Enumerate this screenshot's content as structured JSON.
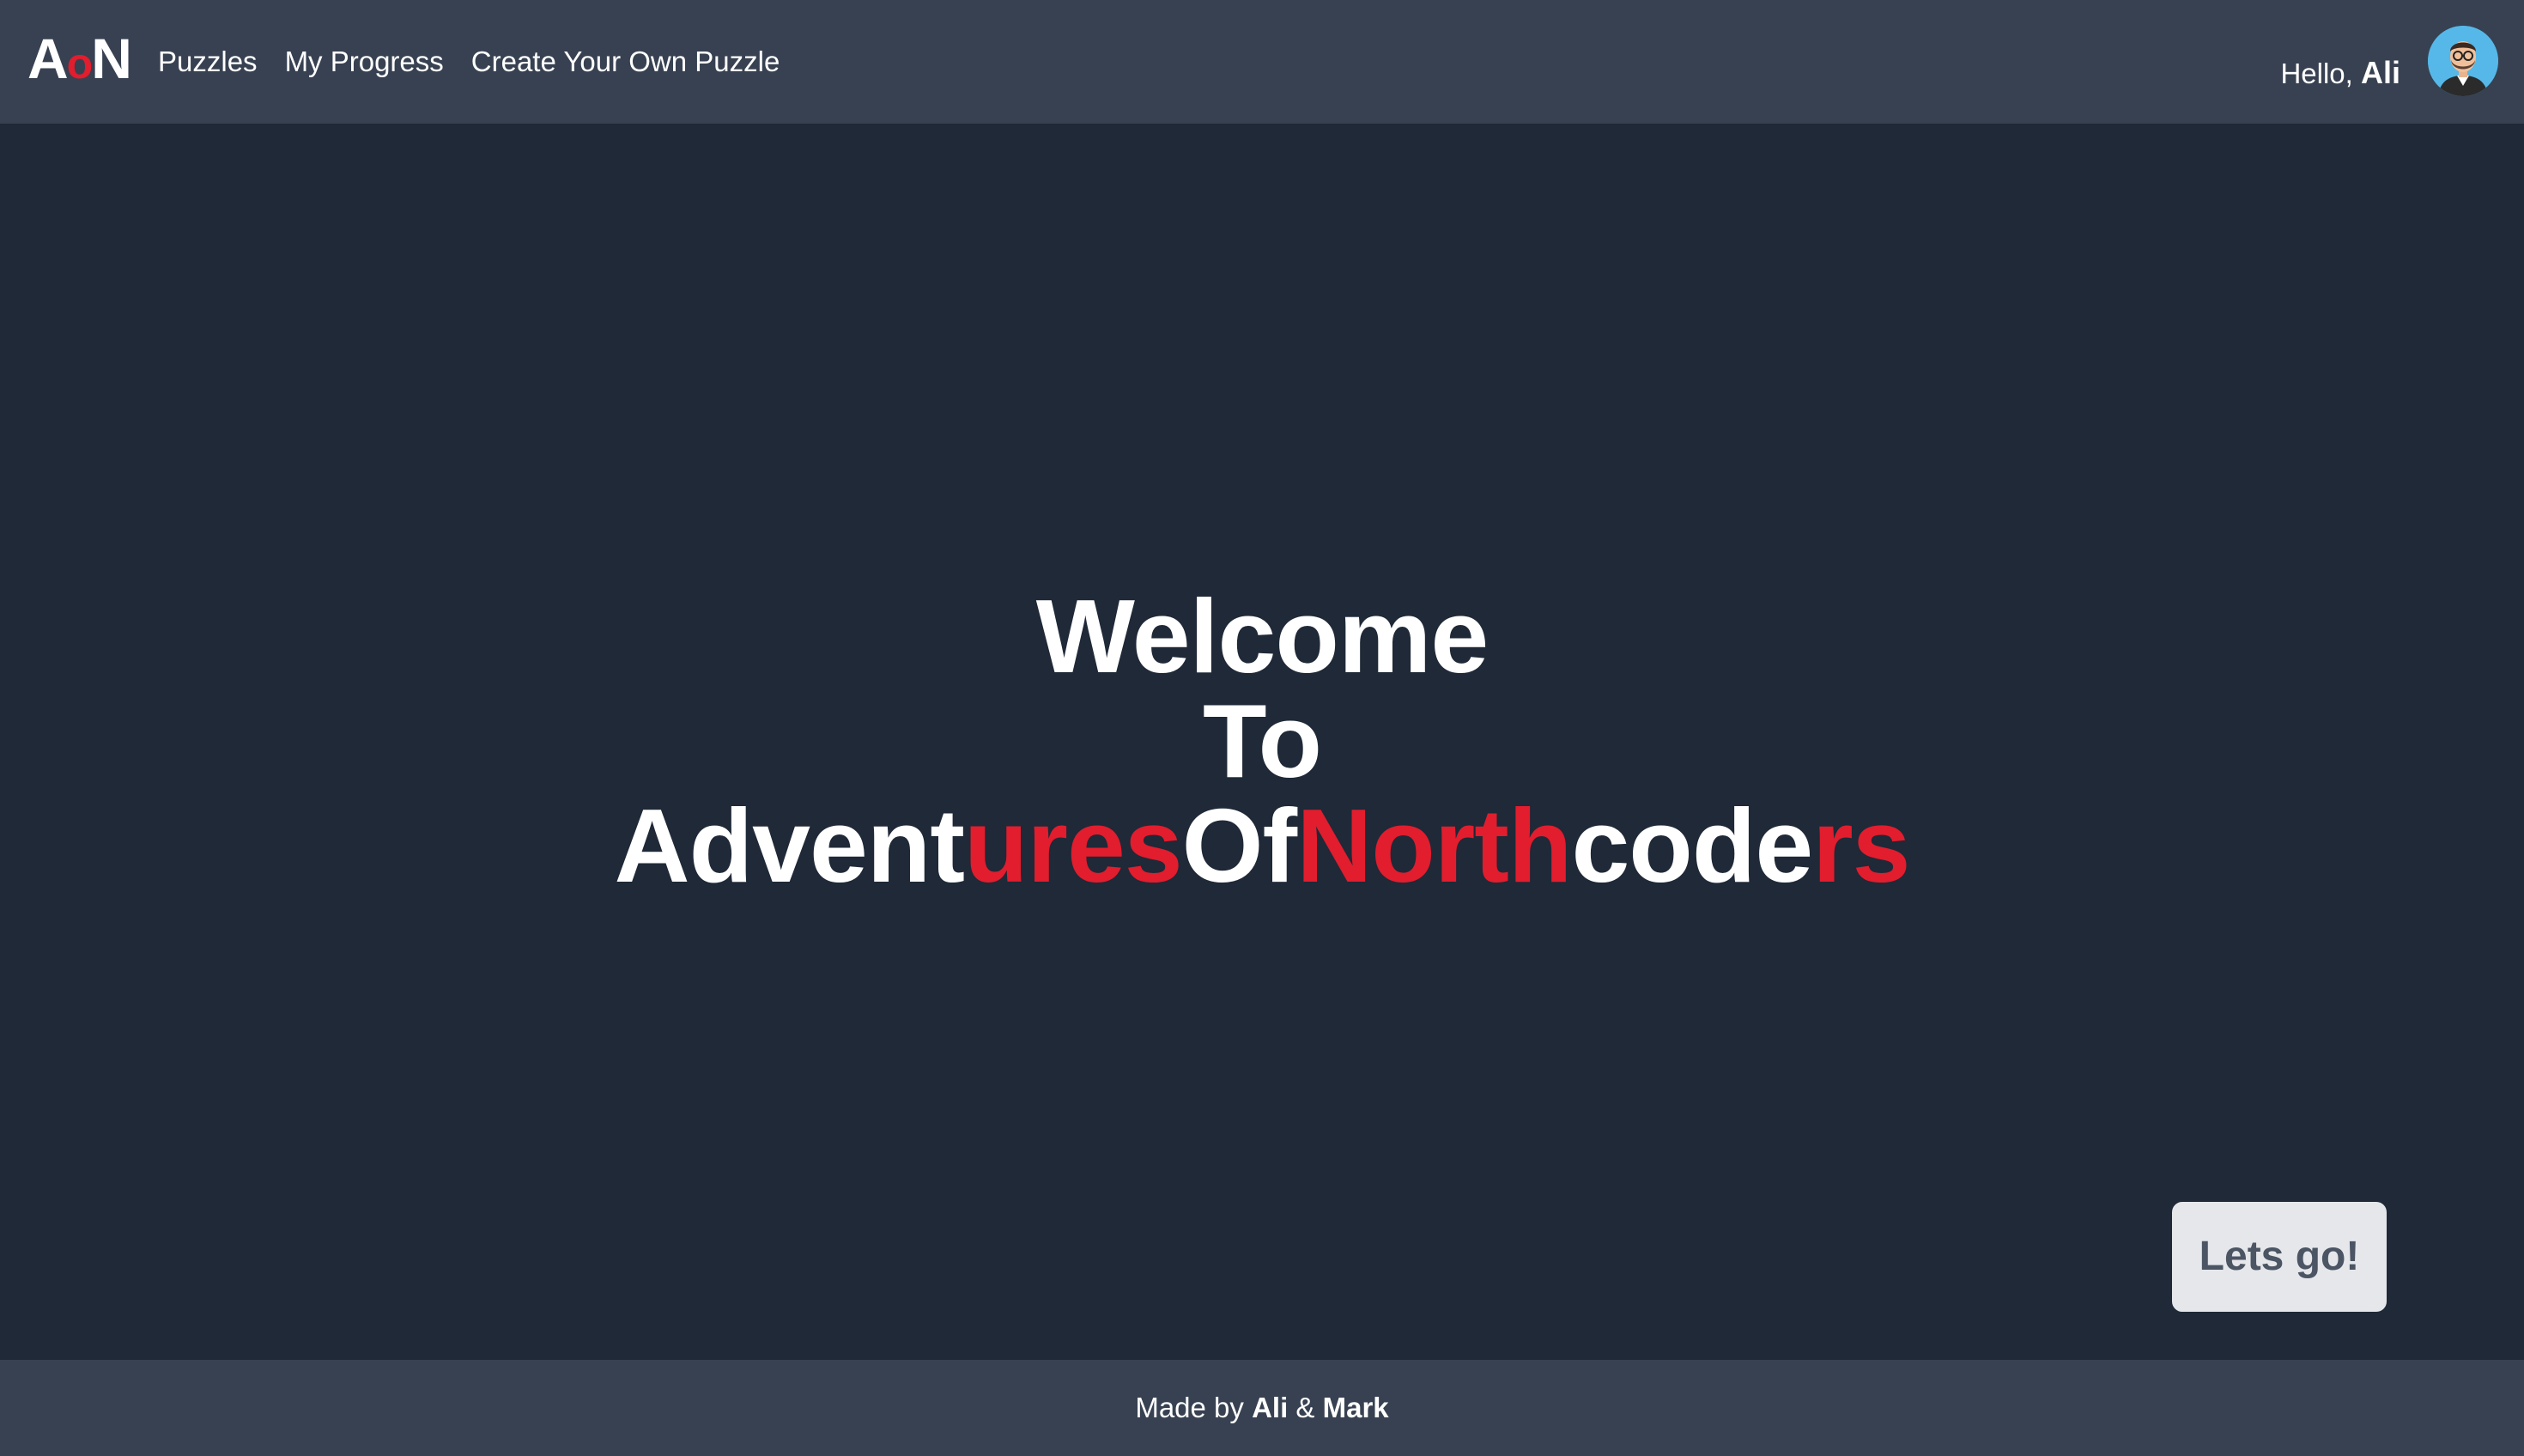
{
  "navbar": {
    "logo": {
      "a": "A",
      "o": "o",
      "n": "N"
    },
    "links": [
      "Puzzles",
      "My Progress",
      "Create Your Own Puzzle"
    ],
    "greeting_prefix": "Hello, ",
    "username": "Ali",
    "avatar_icon": "user-avatar-icon"
  },
  "hero": {
    "line1": "Welcome",
    "line2": "To",
    "line3_parts": [
      "Advent",
      "ures",
      "Of",
      "North",
      "code",
      "rs"
    ]
  },
  "cta": {
    "label": "Lets go!"
  },
  "footer": {
    "prefix": "Made by ",
    "author1": "Ali",
    "separator": " & ",
    "author2": "Mark"
  },
  "colors": {
    "background": "#1f2937",
    "bars": "#374151",
    "accent_red": "#e11d2e",
    "button_bg": "#e5e7eb",
    "button_text": "#4b5563"
  }
}
